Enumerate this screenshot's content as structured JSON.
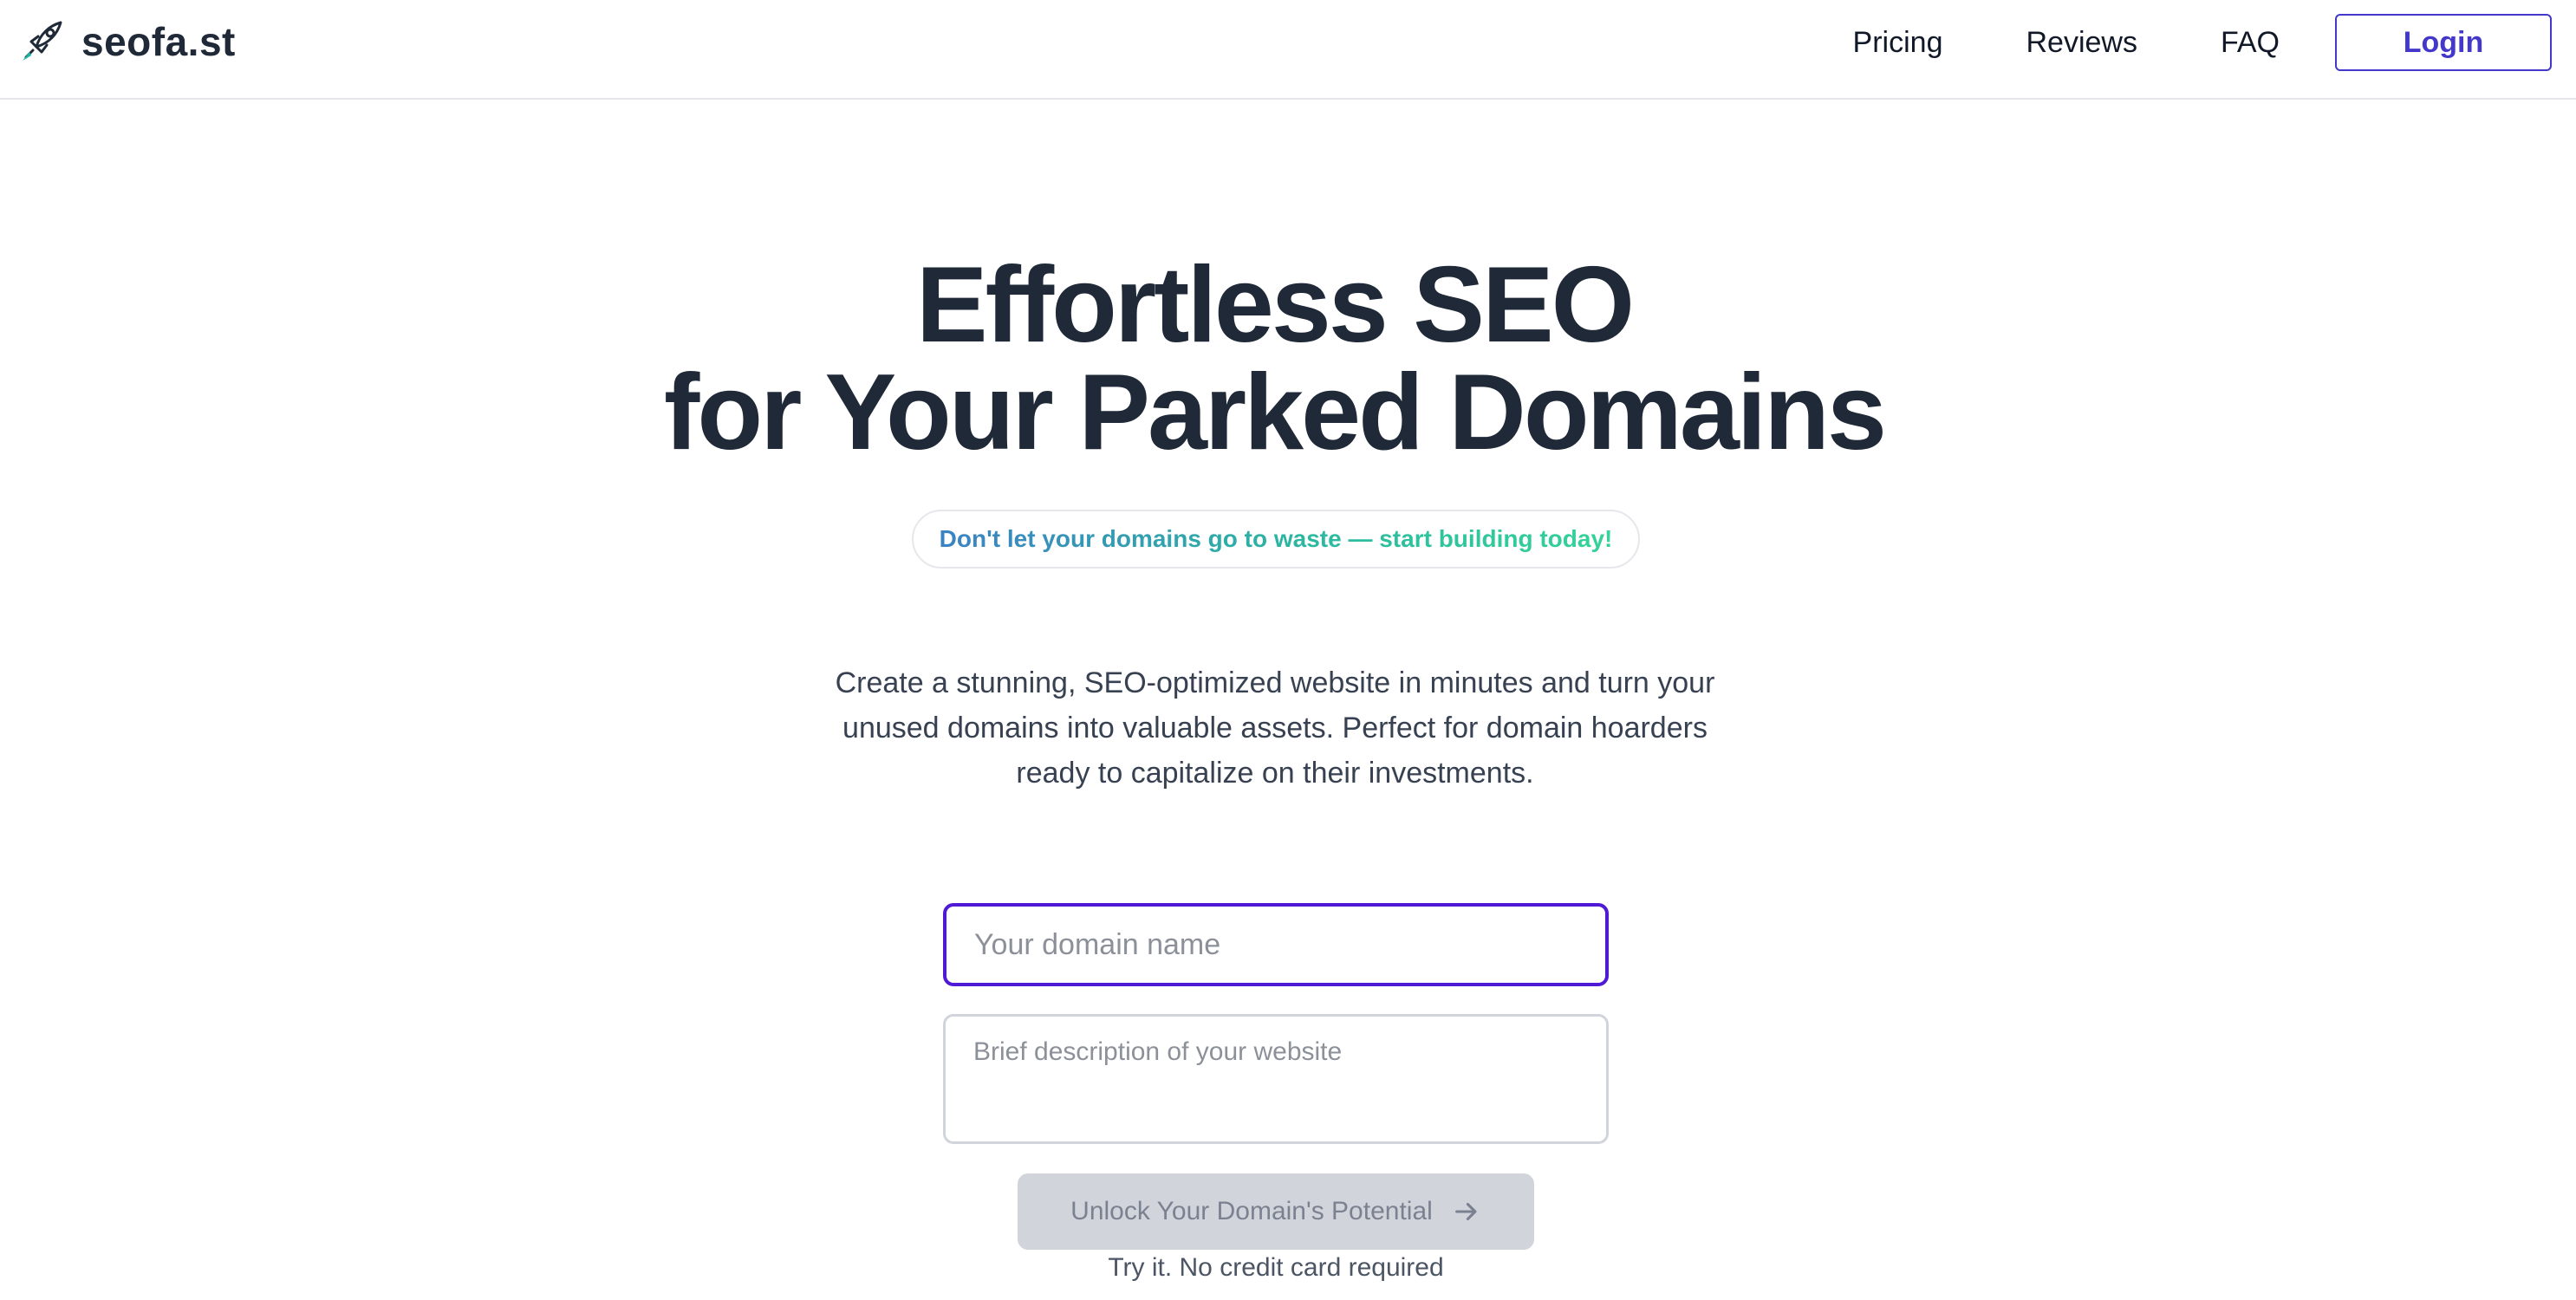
{
  "header": {
    "brand": "seofa.st",
    "nav": {
      "pricing": "Pricing",
      "reviews": "Reviews",
      "faq": "FAQ",
      "login": "Login"
    }
  },
  "hero": {
    "title_line1": "Effortless SEO",
    "title_line2": "for Your Parked Domains",
    "tagline": "Don't let your domains go to waste — start building today!",
    "description": "Create a stunning, SEO-optimized website in minutes and turn your unused domains into valuable assets. Perfect for domain hoarders ready to capitalize on their investments."
  },
  "form": {
    "domain_placeholder": "Your domain name",
    "domain_value": "",
    "description_placeholder": "Brief description of your website",
    "description_value": "",
    "submit_label": "Unlock Your Domain's Potential",
    "submit_icon": "arrow-right-icon",
    "note": "Try it. No credit card required"
  },
  "colors": {
    "accent": "#4338ca",
    "input_focus": "#4f19d6",
    "text_dark": "#1f2937",
    "tagline_gradient_start": "#3b82c4",
    "tagline_gradient_end": "#34d399",
    "button_disabled_bg": "#d1d5db"
  },
  "icons": {
    "brand": "rocket-icon"
  }
}
